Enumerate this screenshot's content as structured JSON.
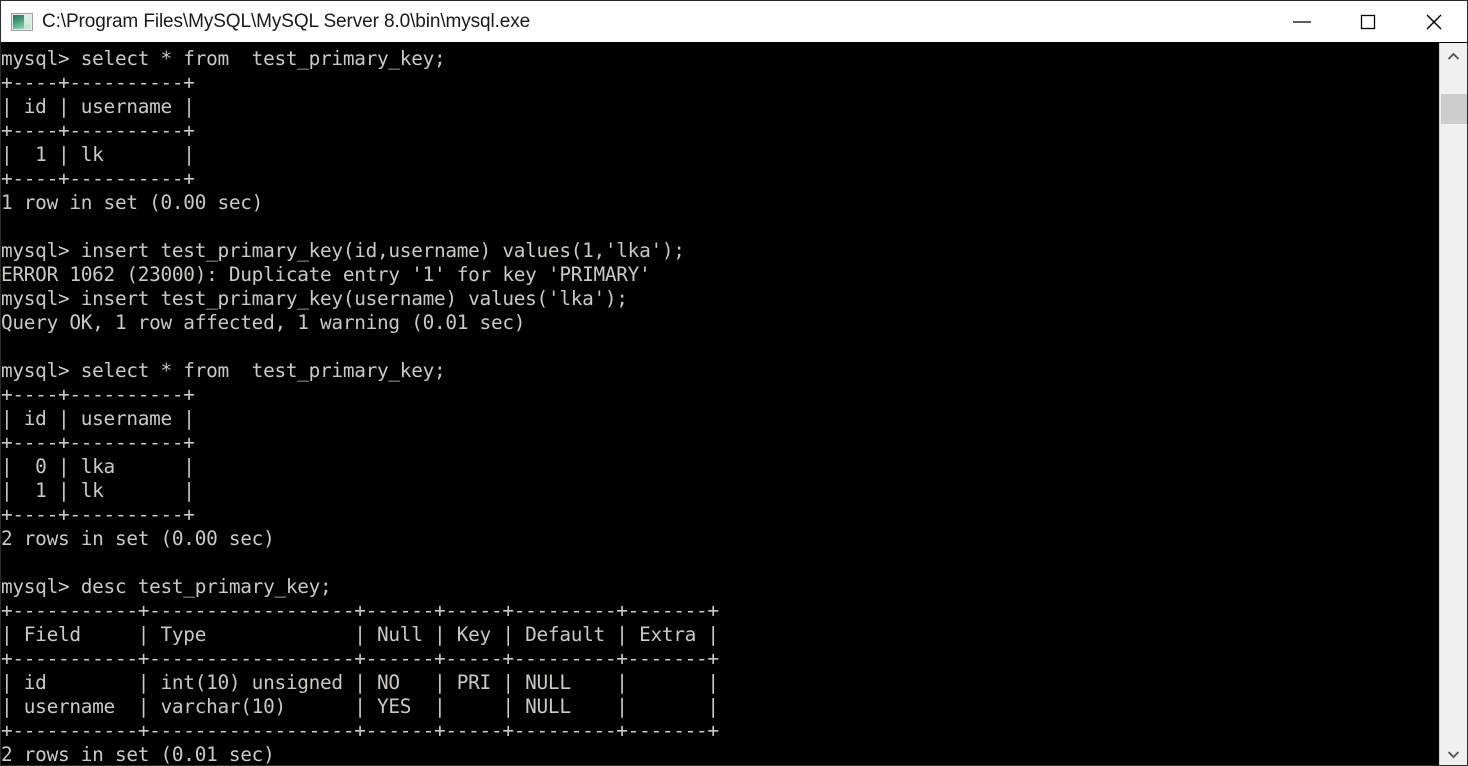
{
  "window": {
    "title": "C:\\Program Files\\MySQL\\MySQL Server 8.0\\bin\\mysql.exe",
    "icon": "mysql-console-icon",
    "background_color": "#000000",
    "text_color": "#ccc9c2",
    "titlebar_color": "#ffffff",
    "controls": {
      "minimize_label": "Minimize",
      "maximize_label": "Maximize",
      "close_label": "Close"
    }
  },
  "scrollbar": {
    "up_arrow_label": "Scroll up",
    "down_arrow_label": "Scroll down",
    "thumb_label": "Scroll thumb"
  },
  "terminal": {
    "prompt": "mysql>",
    "content": "mysql> select * from  test_primary_key;\n+----+----------+\n| id | username |\n+----+----------+\n|  1 | lk       |\n+----+----------+\n1 row in set (0.00 sec)\n\nmysql> insert test_primary_key(id,username) values(1,'lka');\nERROR 1062 (23000): Duplicate entry '1' for key 'PRIMARY'\nmysql> insert test_primary_key(username) values('lka');\nQuery OK, 1 row affected, 1 warning (0.01 sec)\n\nmysql> select * from  test_primary_key;\n+----+----------+\n| id | username |\n+----+----------+\n|  0 | lka      |\n|  1 | lk       |\n+----+----------+\n2 rows in set (0.00 sec)\n\nmysql> desc test_primary_key;\n+-----------+------------------+------+-----+---------+-------+\n| Field     | Type             | Null | Key | Default | Extra |\n+-----------+------------------+------+-----+---------+-------+\n| id        | int(10) unsigned | NO   | PRI | NULL    |       |\n| username  | varchar(10)      | YES  |     | NULL    |       |\n+-----------+------------------+------+-----+---------+-------+\n2 rows in set (0.01 sec)",
    "commands": [
      "select * from  test_primary_key;",
      "insert test_primary_key(id,username) values(1,'lka');",
      "insert test_primary_key(username) values('lka');",
      "select * from  test_primary_key;",
      "desc test_primary_key;"
    ],
    "messages": [
      "1 row in set (0.00 sec)",
      "ERROR 1062 (23000): Duplicate entry '1' for key 'PRIMARY'",
      "Query OK, 1 row affected, 1 warning (0.01 sec)",
      "2 rows in set (0.00 sec)",
      "2 rows in set (0.01 sec)"
    ],
    "result_tables": [
      {
        "name": "select-result-1",
        "columns": [
          "id",
          "username"
        ],
        "rows": [
          [
            "1",
            "lk"
          ]
        ],
        "footer": "1 row in set (0.00 sec)"
      },
      {
        "name": "select-result-2",
        "columns": [
          "id",
          "username"
        ],
        "rows": [
          [
            "0",
            "lka"
          ],
          [
            "1",
            "lk"
          ]
        ],
        "footer": "2 rows in set (0.00 sec)"
      },
      {
        "name": "desc-result",
        "columns": [
          "Field",
          "Type",
          "Null",
          "Key",
          "Default",
          "Extra"
        ],
        "rows": [
          [
            "id",
            "int(10) unsigned",
            "NO",
            "PRI",
            "NULL",
            ""
          ],
          [
            "username",
            "varchar(10)",
            "YES",
            "",
            "NULL",
            ""
          ]
        ],
        "footer": "2 rows in set (0.01 sec)"
      }
    ]
  }
}
